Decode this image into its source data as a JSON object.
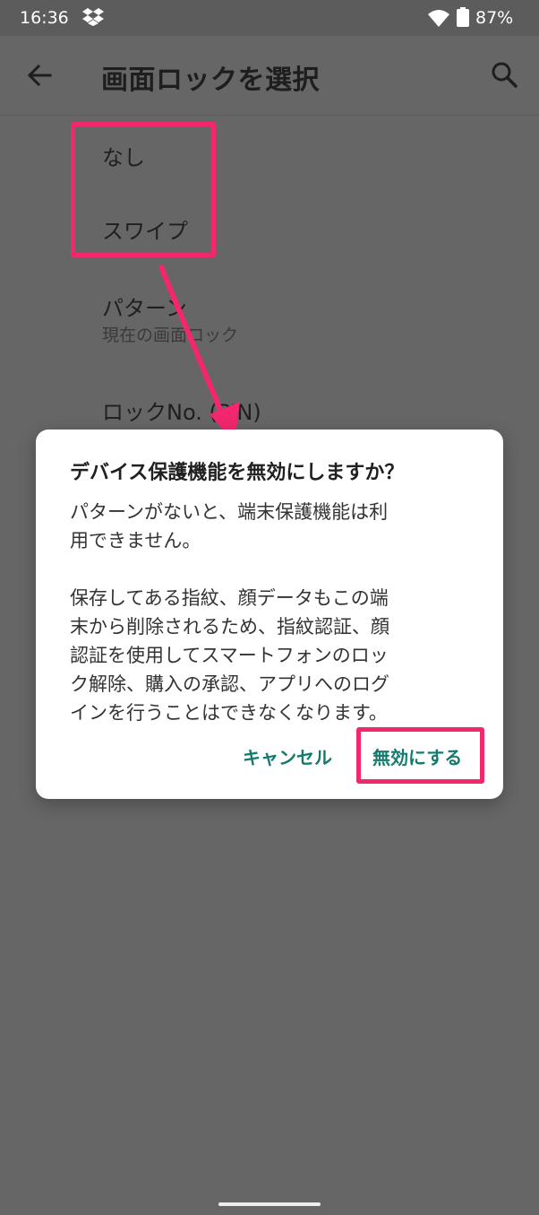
{
  "status_bar": {
    "time": "16:36",
    "battery_pct": "87%"
  },
  "app_bar": {
    "title": "画面ロックを選択"
  },
  "list": {
    "none": "なし",
    "swipe": "スワイプ",
    "pattern": "パターン",
    "pattern_sub": "現在の画面ロック",
    "pin": "ロックNo. (PIN)"
  },
  "dialog": {
    "title": "デバイス保護機能を無効にしますか？",
    "body_1_line_1": "パターンがないと、端末保護機能は利",
    "body_1_line_2": "用できません。",
    "body_2_line_1": "保存してある指紋、顔データもこの端",
    "body_2_line_2": "末から削除されるため、指紋認証、顔",
    "body_2_line_3": "認証を使用してスマートフォンのロッ",
    "body_2_line_4": "ク解除、購入の承認、アプリへのログ",
    "body_2_line_5": "インを行うことはできなくなります。",
    "cancel_label": "キャンセル",
    "confirm_label": "無効にする"
  },
  "colors": {
    "highlight": "#f2276e",
    "accent": "#157a6e",
    "scrim": "#666666"
  }
}
